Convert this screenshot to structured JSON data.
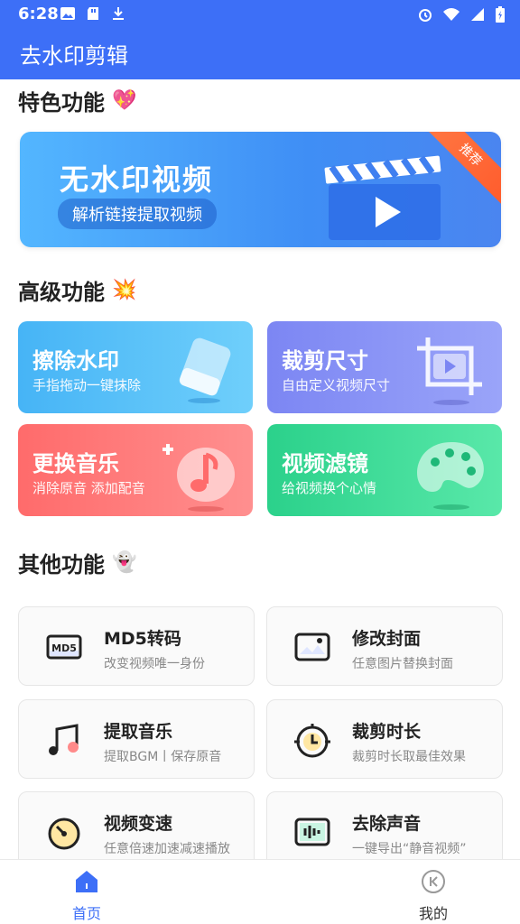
{
  "status": {
    "time": "6:28",
    "icons_left": [
      "image-icon",
      "sd-card-icon",
      "download-icon"
    ],
    "icons_right": [
      "alarm-icon",
      "wifi-icon",
      "signal-icon",
      "battery-icon"
    ]
  },
  "appbar": {
    "title": "去水印剪辑"
  },
  "sections": {
    "featured": {
      "title": "特色功能",
      "emoji": "💖"
    },
    "advanced": {
      "title": "高级功能",
      "emoji": "💥"
    },
    "others": {
      "title": "其他功能",
      "emoji": "👻"
    }
  },
  "banner": {
    "title": "无水印视频",
    "subtitle": "解析链接提取视频",
    "badge": "推荐"
  },
  "advanced_cards": [
    {
      "title": "擦除水印",
      "subtitle": "手指拖动一键抹除",
      "icon": "eraser-icon"
    },
    {
      "title": "裁剪尺寸",
      "subtitle": "自由定义视频尺寸",
      "icon": "crop-icon"
    },
    {
      "title": "更换音乐",
      "subtitle": "消除原音 添加配音",
      "icon": "music-note-icon"
    },
    {
      "title": "视频滤镜",
      "subtitle": "给视频换个心情",
      "icon": "palette-icon"
    }
  ],
  "other_cards": [
    {
      "title": "MD5转码",
      "subtitle": "改变视频唯一身份",
      "icon": "md5-icon"
    },
    {
      "title": "修改封面",
      "subtitle": "任意图片替换封面",
      "icon": "image-icon"
    },
    {
      "title": "提取音乐",
      "subtitle": "提取BGM丨保存原音",
      "icon": "music-icon"
    },
    {
      "title": "裁剪时长",
      "subtitle": "裁剪时长取最佳效果",
      "icon": "timer-icon"
    },
    {
      "title": "视频变速",
      "subtitle": "任意倍速加速减速播放",
      "icon": "speed-icon"
    },
    {
      "title": "去除声音",
      "subtitle": "一键导出“静音视频”",
      "icon": "mute-audio-icon"
    }
  ],
  "bottom_nav": [
    {
      "label": "首页",
      "icon": "home-icon",
      "active": true
    },
    {
      "label": "我的",
      "icon": "profile-icon",
      "active": false
    }
  ],
  "colors": {
    "primary": "#3d6ff7",
    "banner_gradient": [
      "#53b6ff",
      "#3f8ef5"
    ],
    "card_blue": "#46b4f6",
    "card_purple": "#7c86f3",
    "card_red": "#ff6b6b",
    "card_green": "#2bd18b"
  }
}
